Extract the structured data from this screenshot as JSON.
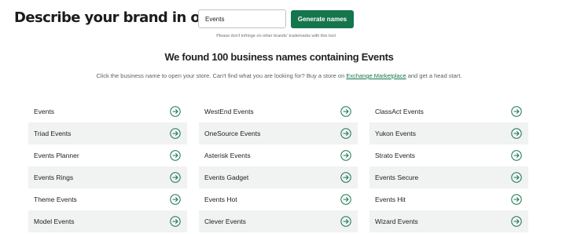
{
  "header": {
    "question": "Describe your brand in one word.",
    "search_value": "Events",
    "generate_label": "Generate names",
    "disclaimer": "Please don't infringe on other brands' trademarks with this tool"
  },
  "results": {
    "title": "We found 100 business names containing Events",
    "subtitle_before": "Click the business name to open your store. Can't find what you are looking for? Buy a store on ",
    "subtitle_link": "Exchange Marketplace",
    "subtitle_after": " and get a head start."
  },
  "names": {
    "rows": [
      [
        "Events",
        "WestEnd Events",
        "ClassAct Events"
      ],
      [
        "Triad Events",
        "OneSource Events",
        "Yukon Events"
      ],
      [
        "Events Planner",
        "Asterisk Events",
        "Strato Events"
      ],
      [
        "Events Rings",
        "Events Gadget",
        "Events Secure"
      ],
      [
        "Theme Events",
        "Events Hot",
        "Events Hit"
      ],
      [
        "Model Events",
        "Clever Events",
        "Wizard Events"
      ]
    ],
    "icon": "arrow-right-circle-icon"
  },
  "colors": {
    "accent": "#15754d",
    "row_alt_bg": "#f1f2f2",
    "text": "#212326"
  }
}
